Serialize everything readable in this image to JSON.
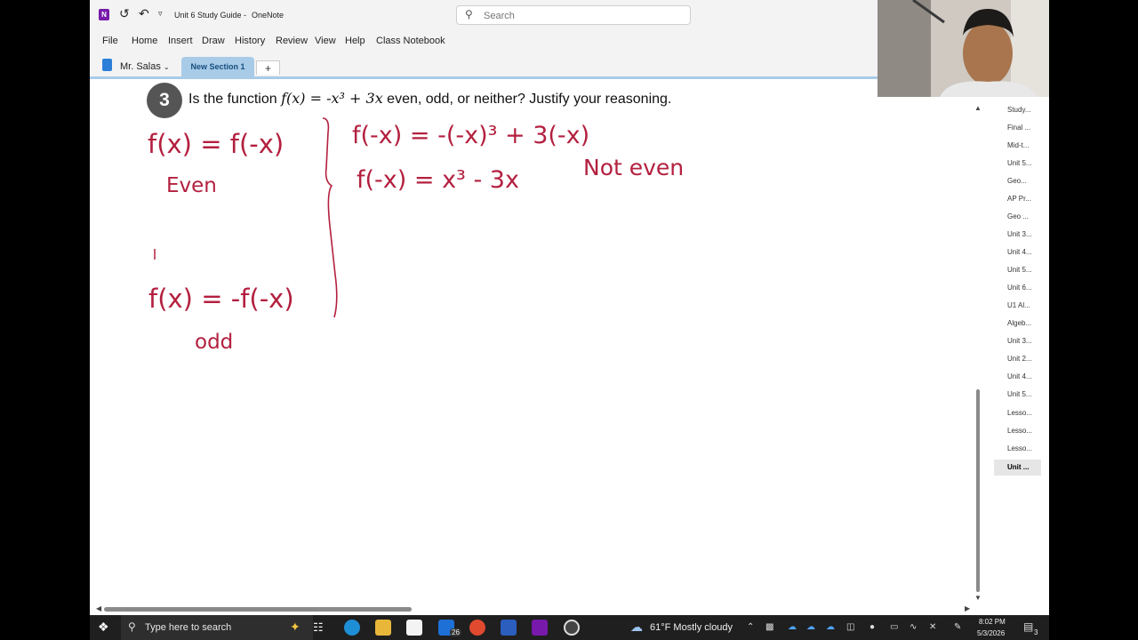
{
  "titlebar": {
    "app_title": "Unit 6 Study Guide",
    "separator": "-",
    "app_name": "OneNote",
    "search_placeholder": "Search"
  },
  "menu": [
    "File",
    "Home",
    "Insert",
    "Draw",
    "History",
    "Review",
    "View",
    "Help",
    "Class Notebook"
  ],
  "notebook": {
    "name": "Mr. Salas",
    "section_tab": "New Section 1",
    "add_tab": "+"
  },
  "question": {
    "number": "3",
    "text_before": "Is the function",
    "math": "f(x) = -x³ + 3x",
    "text_after": "even, odd, or neither? Justify your reasoning."
  },
  "handwriting": {
    "even_rule": "f(x) = f(-x)",
    "even_label": "Even",
    "odd_rule": "f(x) = -f(-x)",
    "odd_label": "odd",
    "step1": "f(-x) = -(-x)³ + 3(-x)",
    "step2": "f(-x) = x³ - 3x",
    "verdict": "Not even",
    "ink_color": "#b3203f"
  },
  "pages": [
    "Study...",
    "Final ...",
    "Mid-t...",
    "Unit 5...",
    "Geo...",
    "AP Pr...",
    "Geo ...",
    "Unit 3...",
    "Unit 4...",
    "Unit 5...",
    "Unit 6...",
    "U1 Al...",
    "Algeb...",
    "Unit 3...",
    "Unit 2...",
    "Unit 4...",
    "Unit 5...",
    "Lesso...",
    "Lesso...",
    "Lesso...",
    "Unit ..."
  ],
  "active_page_index": 20,
  "taskbar": {
    "search_placeholder": "Type here to search",
    "mail_badge": "26",
    "weather": "61°F  Mostly cloudy",
    "time": "8:02 PM",
    "date": "5/3/2026",
    "notification_count": "3"
  }
}
